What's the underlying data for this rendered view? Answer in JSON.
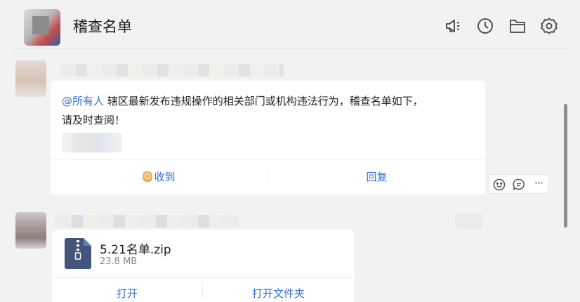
{
  "header": {
    "title": "稽查名单",
    "icons": [
      "announcement-icon",
      "history-clock-icon",
      "folder-icon",
      "settings-gear-icon"
    ]
  },
  "messages": [
    {
      "type": "notice",
      "mention": "@所有人",
      "line1": " 辖区最新发布违规操作的相关部门或机构违法行为，稽查名单如下，",
      "line2": "请及时查阅！",
      "actions": {
        "receive": "收到",
        "reply": "回复"
      }
    },
    {
      "type": "file",
      "file_name": "5.21名单.zip",
      "file_size": "23.8 MB",
      "actions": {
        "open": "打开",
        "open_folder": "打开文件夹"
      }
    }
  ],
  "message_tools": {
    "more": "···"
  },
  "colors": {
    "accent": "#3370d8",
    "background": "#f2f2f2",
    "card": "#ffffff",
    "zip_icon": "#44557d"
  }
}
